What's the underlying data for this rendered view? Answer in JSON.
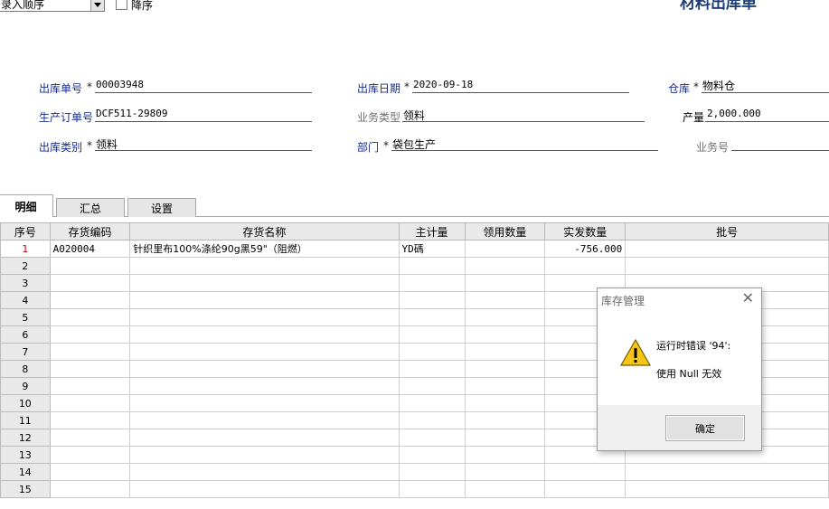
{
  "toolbar": {
    "sort_value": "录入顺序",
    "descending_label": "降序",
    "descending_checked": false
  },
  "doc_title": "材料出库单",
  "form": {
    "out_no": {
      "label": "出库单号",
      "required": "*",
      "value": "00003948"
    },
    "out_date": {
      "label": "出库日期",
      "required": "*",
      "value": "2020-09-18"
    },
    "warehouse": {
      "label": "仓库",
      "required": "*",
      "value": "物料仓"
    },
    "order_no": {
      "label": "生产订单号",
      "value": "DCF511-29809"
    },
    "biz_type": {
      "label": "业务类型",
      "value": "领料"
    },
    "output": {
      "label": "产量",
      "value": "2,000.000"
    },
    "out_category": {
      "label": "出库类别",
      "required": "*",
      "value": "领料"
    },
    "dept": {
      "label": "部门",
      "required": "*",
      "value": "袋包生产"
    },
    "biz_no": {
      "label": "业务号",
      "value": ""
    }
  },
  "tabs": [
    {
      "label": "明细",
      "active": true
    },
    {
      "label": "汇总",
      "active": false
    },
    {
      "label": "设置",
      "active": false
    }
  ],
  "grid": {
    "headers": [
      "序号",
      "存货编码",
      "存货名称",
      "主计量",
      "领用数量",
      "实发数量",
      "批号"
    ],
    "rows": [
      {
        "no": "1",
        "code": "A020004",
        "name": "针织里布100%涤纶90g黑59\"（阻燃）",
        "unit": "YD碼",
        "req_qty": "",
        "actual_qty": "-756.000",
        "batch": ""
      },
      {
        "no": "2",
        "code": "",
        "name": "",
        "unit": "",
        "req_qty": "",
        "actual_qty": "",
        "batch": ""
      },
      {
        "no": "3",
        "code": "",
        "name": "",
        "unit": "",
        "req_qty": "",
        "actual_qty": "",
        "batch": ""
      },
      {
        "no": "4",
        "code": "",
        "name": "",
        "unit": "",
        "req_qty": "",
        "actual_qty": "",
        "batch": ""
      },
      {
        "no": "5",
        "code": "",
        "name": "",
        "unit": "",
        "req_qty": "",
        "actual_qty": "",
        "batch": ""
      },
      {
        "no": "6",
        "code": "",
        "name": "",
        "unit": "",
        "req_qty": "",
        "actual_qty": "",
        "batch": ""
      },
      {
        "no": "7",
        "code": "",
        "name": "",
        "unit": "",
        "req_qty": "",
        "actual_qty": "",
        "batch": ""
      },
      {
        "no": "8",
        "code": "",
        "name": "",
        "unit": "",
        "req_qty": "",
        "actual_qty": "",
        "batch": ""
      },
      {
        "no": "9",
        "code": "",
        "name": "",
        "unit": "",
        "req_qty": "",
        "actual_qty": "",
        "batch": ""
      },
      {
        "no": "10",
        "code": "",
        "name": "",
        "unit": "",
        "req_qty": "",
        "actual_qty": "",
        "batch": ""
      },
      {
        "no": "11",
        "code": "",
        "name": "",
        "unit": "",
        "req_qty": "",
        "actual_qty": "",
        "batch": ""
      },
      {
        "no": "12",
        "code": "",
        "name": "",
        "unit": "",
        "req_qty": "",
        "actual_qty": "",
        "batch": ""
      },
      {
        "no": "13",
        "code": "",
        "name": "",
        "unit": "",
        "req_qty": "",
        "actual_qty": "",
        "batch": ""
      },
      {
        "no": "14",
        "code": "",
        "name": "",
        "unit": "",
        "req_qty": "",
        "actual_qty": "",
        "batch": ""
      },
      {
        "no": "15",
        "code": "",
        "name": "",
        "unit": "",
        "req_qty": "",
        "actual_qty": "",
        "batch": ""
      }
    ]
  },
  "dialog": {
    "title": "库存管理",
    "message_line1": "运行时错误 '94':",
    "message_line2": "使用 Null 无效",
    "ok_label": "确定",
    "icon": "warning-icon"
  },
  "colors": {
    "label_blue": "#1a2d8c",
    "current_row_red": "#c00000",
    "title_blue": "#1f3f7a"
  }
}
